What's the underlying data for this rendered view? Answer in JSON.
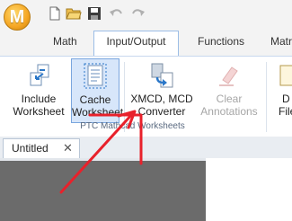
{
  "app": {
    "logo_letter": "M"
  },
  "quick_access": {
    "icons": [
      "new-document-icon",
      "open-folder-icon",
      "save-icon",
      "undo-icon",
      "redo-icon"
    ]
  },
  "tabs": [
    {
      "label": "Math"
    },
    {
      "label": "Input/Output",
      "active": true
    },
    {
      "label": "Functions"
    },
    {
      "label": "Matr"
    }
  ],
  "ribbon": {
    "group_label": "PTC Mathcad Worksheets",
    "buttons": [
      {
        "line1": "Include",
        "line2": "Worksheet",
        "icon": "include-worksheet-icon"
      },
      {
        "line1": "Cache",
        "line2": "Worksheet",
        "icon": "cache-worksheet-icon",
        "selected": true
      },
      {
        "line1": "XMCD, MCD",
        "line2": "Converter",
        "icon": "converter-icon"
      },
      {
        "line1": "Clear",
        "line2": "Annotations",
        "icon": "clear-annotations-icon",
        "disabled": true
      },
      {
        "line1": "D",
        "line2": "File",
        "icon": "data-file-icon"
      }
    ]
  },
  "document": {
    "tab_title": "Untitled",
    "close_symbol": "✕"
  },
  "colors": {
    "accent": "#f5a623",
    "annotation_arrow": "#e8212b",
    "workspace": "#6b6b6b"
  }
}
